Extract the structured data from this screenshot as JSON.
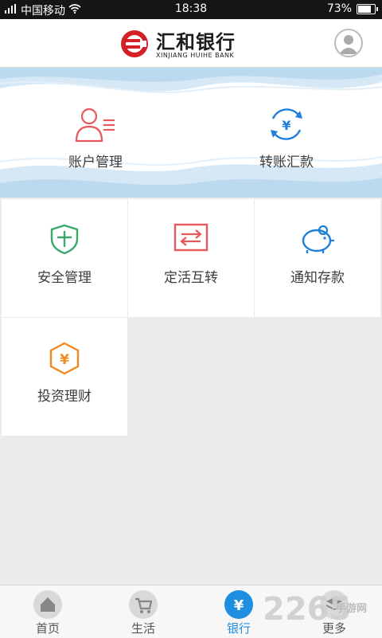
{
  "status_bar": {
    "carrier": "中国移动",
    "time": "18:38",
    "battery": "73%",
    "battery_level": 0.73
  },
  "header": {
    "bank_name_cn": "汇和银行",
    "bank_name_en": "XINJIANG HUIHE BANK"
  },
  "banner": {
    "items": [
      {
        "label": "账户管理",
        "icon": "account-user-icon",
        "color": "#e8585a"
      },
      {
        "label": "转账汇款",
        "icon": "transfer-yuan-icon",
        "color": "#1e80d8"
      }
    ]
  },
  "grid": {
    "items": [
      {
        "label": "安全管理",
        "icon": "shield-icon",
        "color": "#3aa76d"
      },
      {
        "label": "定活互转",
        "icon": "exchange-icon",
        "color": "#e8585a"
      },
      {
        "label": "通知存款",
        "icon": "piggy-bank-icon",
        "color": "#1e80d8"
      },
      {
        "label": "投资理财",
        "icon": "yuan-hexagon-icon",
        "color": "#f08a1e"
      }
    ]
  },
  "tabbar": {
    "items": [
      {
        "label": "首页",
        "icon": "home-icon"
      },
      {
        "label": "生活",
        "icon": "cart-icon"
      },
      {
        "label": "银行",
        "icon": "yuan-icon",
        "active": true
      },
      {
        "label": "更多",
        "icon": "layers-icon"
      }
    ]
  },
  "watermark": {
    "number": "2265",
    "text": "手游网"
  },
  "colors": {
    "accent": "#1e8ee0",
    "status_bar": "#151515",
    "background": "#ebebeb"
  }
}
